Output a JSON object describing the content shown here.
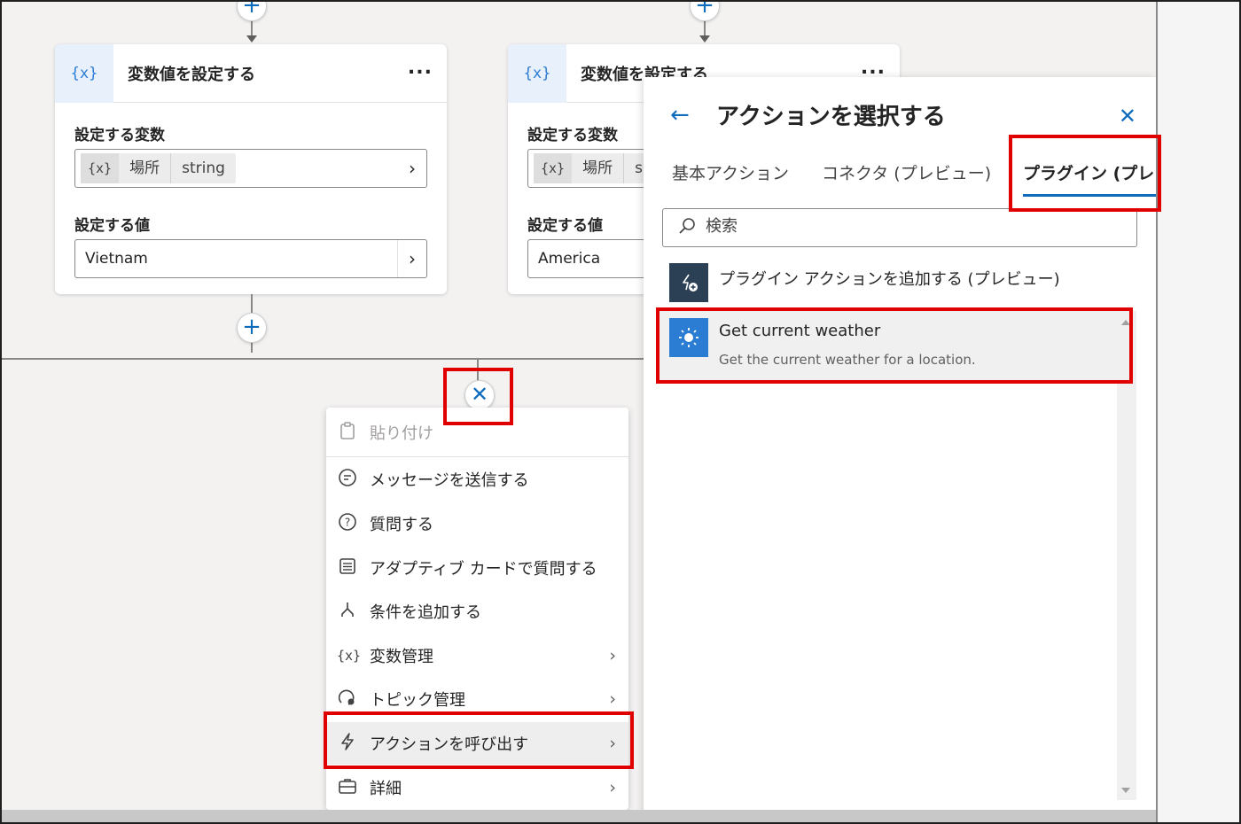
{
  "node_left": {
    "icon": "{x}",
    "title": "変数値を設定する",
    "more": "...",
    "var_label": "設定する変数",
    "var_chip_icon": "{x}",
    "var_name": "場所",
    "var_type": "string",
    "value_label": "設定する値",
    "value": "Vietnam"
  },
  "node_right": {
    "icon": "{x}",
    "title": "変数値を設定する",
    "more": "...",
    "var_label": "設定する変数",
    "var_chip_icon": "{x}",
    "var_name": "場所",
    "var_type": "s",
    "value_label": "設定する値",
    "value": "America"
  },
  "icons": {
    "plus": "+",
    "close": "✕",
    "chevron": "›",
    "back": "←"
  },
  "menu": {
    "items": [
      {
        "label": "貼り付け",
        "icon": "clipboard-icon",
        "disabled": true
      },
      {
        "label": "メッセージを送信する",
        "icon": "chat-icon"
      },
      {
        "label": "質問する",
        "icon": "question-icon"
      },
      {
        "label": "アダプティブ カードで質問する",
        "icon": "card-icon"
      },
      {
        "label": "条件を追加する",
        "icon": "branch-icon"
      },
      {
        "label": "変数管理",
        "icon": "variable-icon",
        "submenu": true
      },
      {
        "label": "トピック管理",
        "icon": "topic-icon",
        "submenu": true
      },
      {
        "label": "アクションを呼び出す",
        "icon": "lightning-icon",
        "submenu": true,
        "selected": true
      },
      {
        "label": "詳細",
        "icon": "briefcase-icon",
        "submenu": true
      }
    ]
  },
  "panel": {
    "title": "アクションを選択する",
    "tabs": [
      "基本アクション",
      "コネクタ (プレビュー)",
      "プラグイン (プレ"
    ],
    "active_tab": "プラグイン (プレ",
    "search_placeholder": "検索",
    "rows": [
      {
        "title": "プラグイン アクションを追加する (プレビュー)",
        "icon": "plugin-add-icon",
        "icon_bg": "#2b3f55"
      },
      {
        "title": "Get current weather",
        "desc": "Get the current weather for a location.",
        "icon": "sun-icon",
        "icon_bg": "#2b7cd3"
      }
    ]
  },
  "colors": {
    "accent": "#0f6cbd",
    "highlight": "#e00000"
  }
}
